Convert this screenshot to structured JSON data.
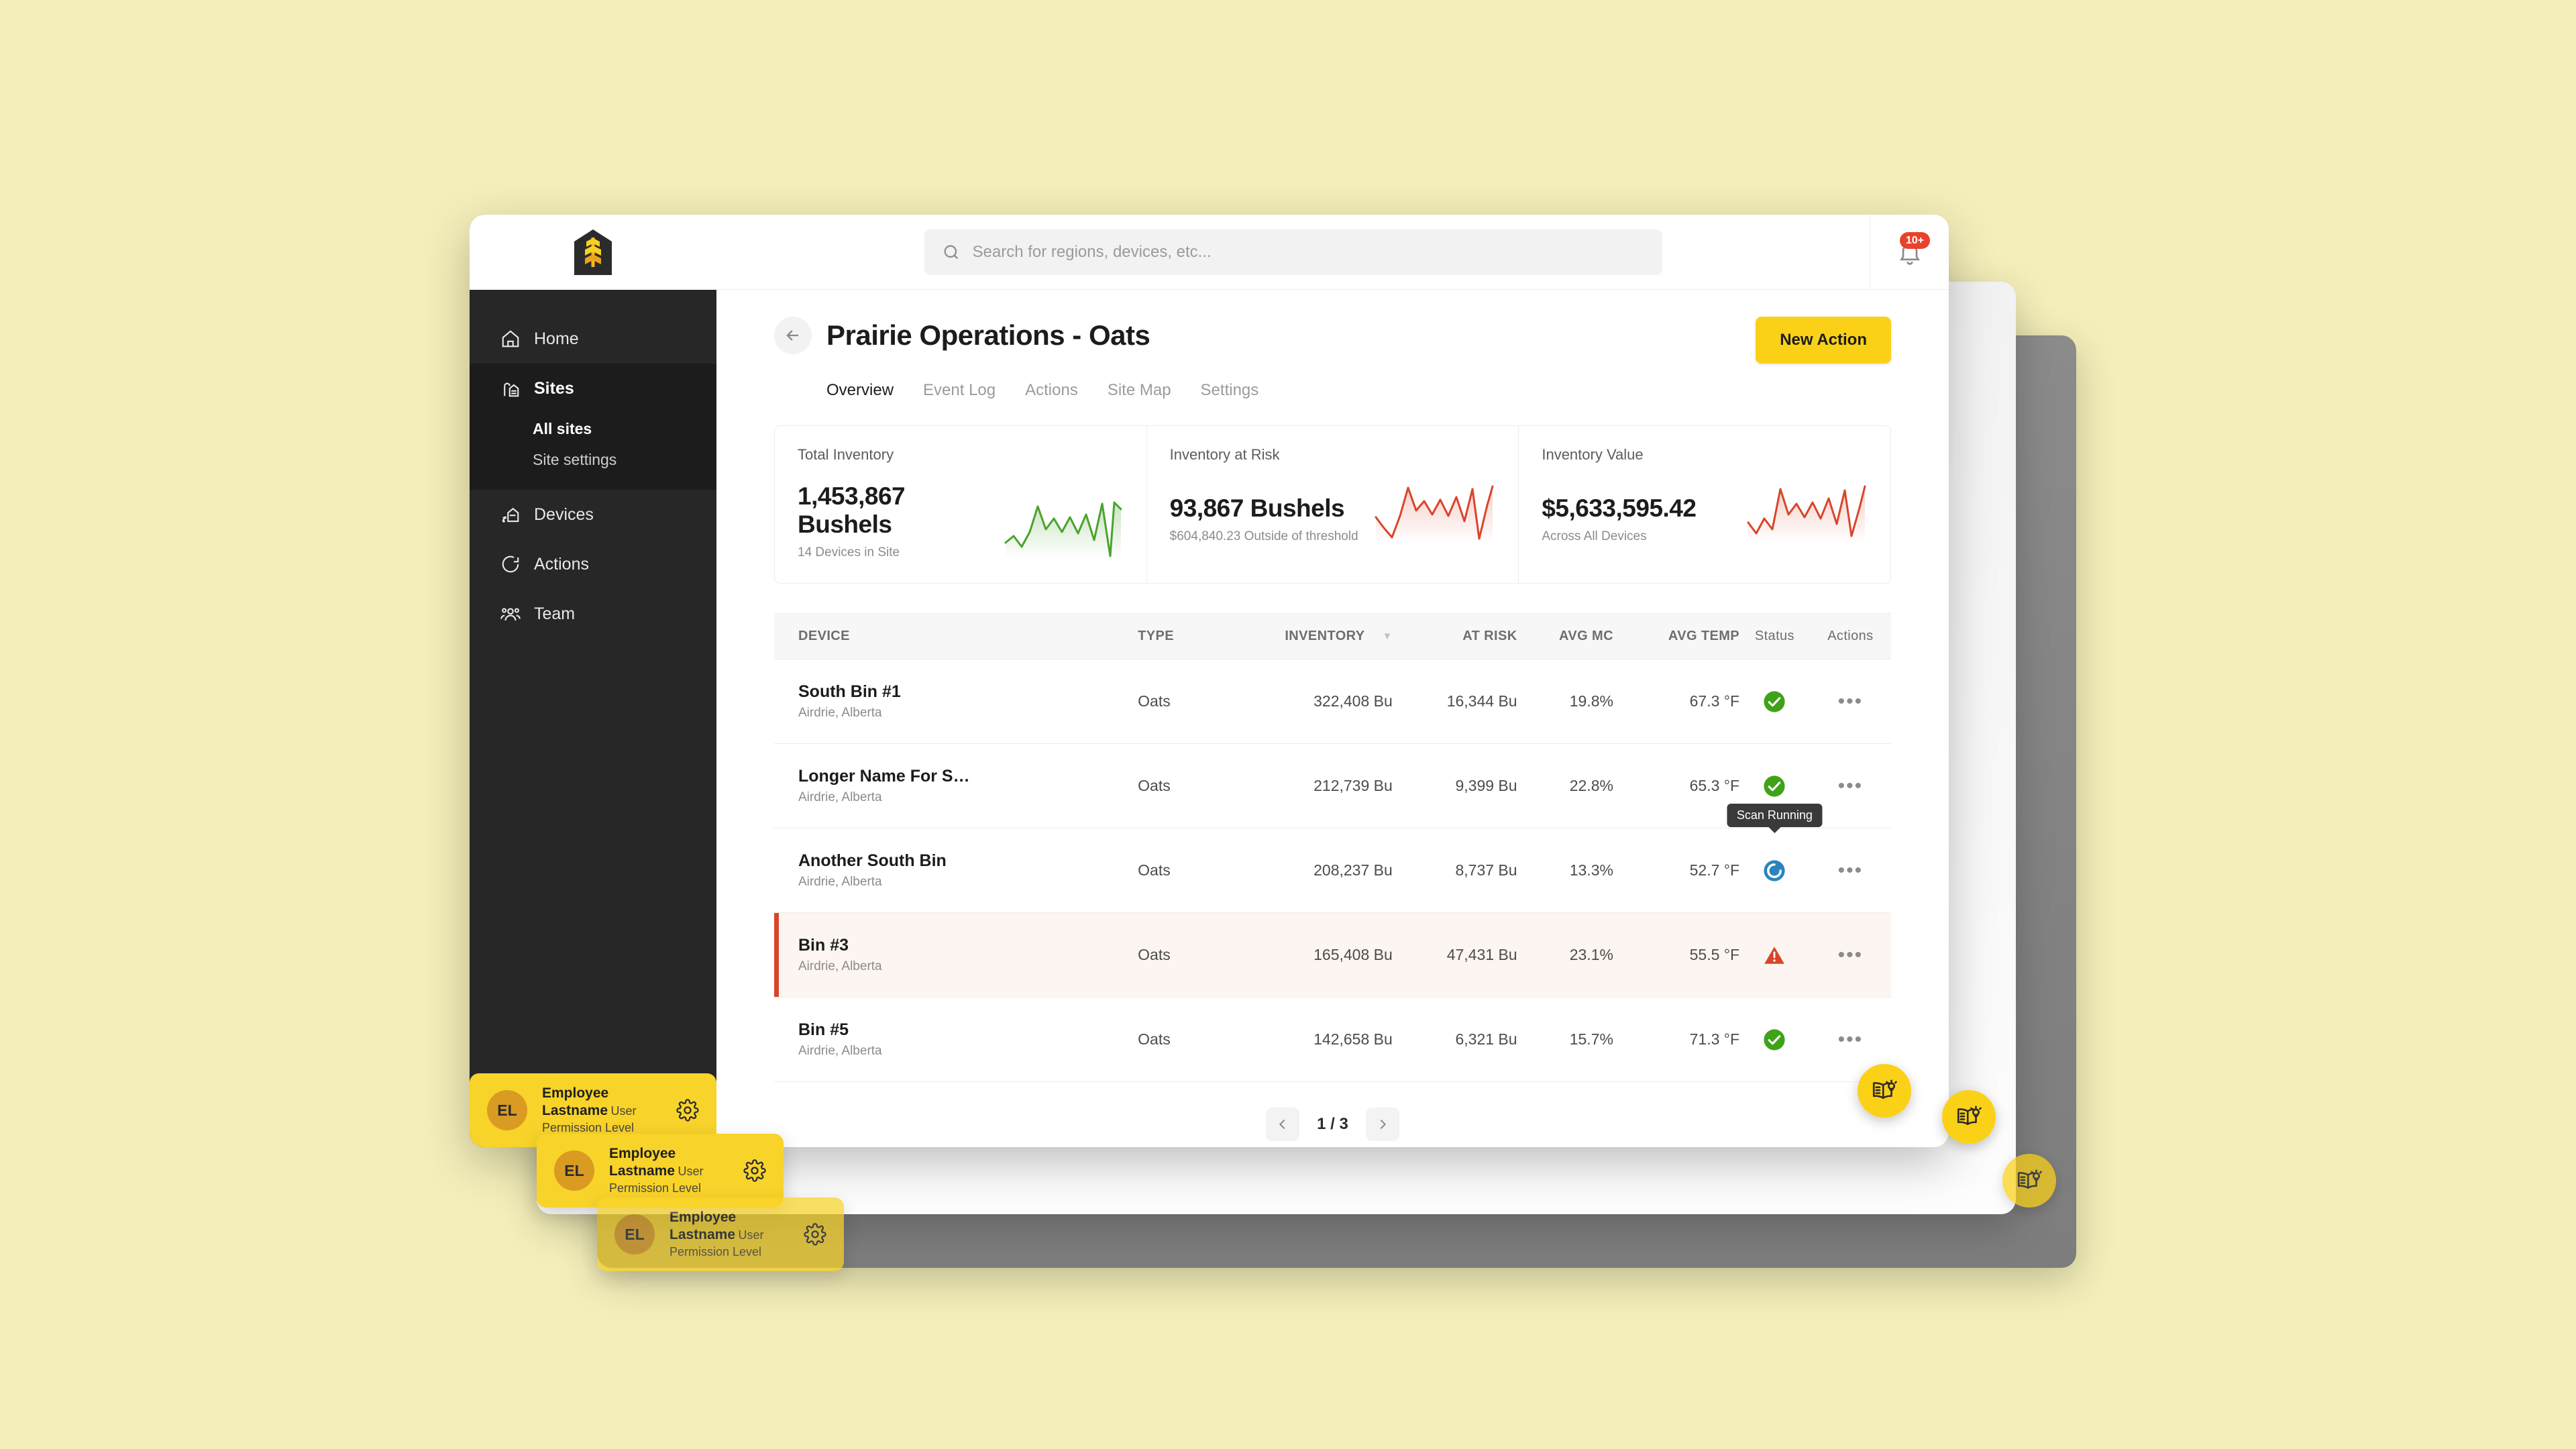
{
  "brand": {
    "logo_name": "wheat-shield-logo",
    "accent": "#fbd117",
    "dark": "#272727"
  },
  "search": {
    "placeholder": "Search for regions, devices, etc...",
    "value": ""
  },
  "notifications": {
    "badge": "10+",
    "icon": "bell-icon"
  },
  "sidebar": {
    "items": [
      {
        "label": "Home",
        "icon": "home-icon",
        "active": false
      },
      {
        "label": "Sites",
        "icon": "silo-icon",
        "active": true
      },
      {
        "label": "Devices",
        "icon": "device-icon",
        "active": false
      },
      {
        "label": "Actions",
        "icon": "actions-icon",
        "active": false
      },
      {
        "label": "Team",
        "icon": "team-icon",
        "active": false
      }
    ],
    "sub_items": [
      {
        "label": "All sites",
        "active": true
      },
      {
        "label": "Site settings",
        "active": false
      }
    ],
    "profile": {
      "initials": "EL",
      "name": "Employee Lastname",
      "role": "User Permission Level",
      "settings_icon": "gear-icon"
    }
  },
  "header": {
    "title": "Prairie Operations - Oats",
    "back_icon": "arrow-left-icon",
    "primary_button": "New Action",
    "tabs": [
      {
        "label": "Overview",
        "active": true
      },
      {
        "label": "Event Log",
        "active": false
      },
      {
        "label": "Actions",
        "active": false
      },
      {
        "label": "Site Map",
        "active": false
      },
      {
        "label": "Settings",
        "active": false
      }
    ]
  },
  "stats": [
    {
      "label": "Total Inventory",
      "value": "1,453,867 Bushels",
      "sub": "14 Devices in Site",
      "color": "#4aa32e"
    },
    {
      "label": "Inventory at Risk",
      "value": "93,867 Bushels",
      "sub": "$604,840.23 Outside of threshold",
      "color": "#d9452a"
    },
    {
      "label": "Inventory Value",
      "value": "$5,633,595.42",
      "sub": "Across All Devices",
      "color": "#d9452a"
    }
  ],
  "chart_data": [
    {
      "type": "line",
      "title": "Total Inventory",
      "series": [
        {
          "name": "Total Inventory",
          "values": [
            30,
            46,
            28,
            62,
            100,
            52,
            72,
            48,
            70,
            44,
            76,
            36,
            96,
            14,
            100,
            88
          ]
        }
      ],
      "color": "#4aa32e",
      "grid": false,
      "legend": "none",
      "ylim": [
        0,
        100
      ]
    },
    {
      "type": "line",
      "title": "Inventory at Risk",
      "series": [
        {
          "name": "Inventory at Risk",
          "values": [
            44,
            30,
            14,
            46,
            100,
            58,
            72,
            50,
            72,
            46,
            76,
            38,
            94,
            14,
            66,
            100
          ]
        }
      ],
      "color": "#d9452a",
      "grid": false,
      "legend": "none",
      "ylim": [
        0,
        100
      ]
    },
    {
      "type": "line",
      "title": "Inventory Value",
      "series": [
        {
          "name": "Inventory Value",
          "values": [
            36,
            22,
            42,
            28,
            98,
            46,
            70,
            44,
            68,
            40,
            80,
            34,
            92,
            18,
            62,
            100
          ]
        }
      ],
      "color": "#d9452a",
      "grid": false,
      "legend": "none",
      "ylim": [
        0,
        100
      ]
    }
  ],
  "table": {
    "columns": [
      "DEVICE",
      "TYPE",
      "INVENTORY",
      "AT RISK",
      "AVG MC",
      "AVG TEMP",
      "Status",
      "Actions"
    ],
    "sorted_column": "INVENTORY",
    "sort_direction": "desc",
    "rows": [
      {
        "device": "South Bin #1",
        "location": "Airdrie, Alberta",
        "type": "Oats",
        "inventory": "322,408 Bu",
        "at_risk": "16,344 Bu",
        "avg_mc": "19.8%",
        "avg_temp": "67.3 °F",
        "status": "ok",
        "actions": "•••",
        "alert": false
      },
      {
        "device": "Longer Name For South Bi...",
        "location": "Airdrie, Alberta",
        "type": "Oats",
        "inventory": "212,739 Bu",
        "at_risk": "9,399 Bu",
        "avg_mc": "22.8%",
        "avg_temp": "65.3 °F",
        "status": "ok",
        "actions": "•••",
        "alert": false
      },
      {
        "device": "Another South Bin",
        "location": "Airdrie, Alberta",
        "type": "Oats",
        "inventory": "208,237 Bu",
        "at_risk": "8,737 Bu",
        "avg_mc": "13.3%",
        "avg_temp": "52.7 °F",
        "status": "scanning",
        "tooltip": "Scan Running",
        "actions": "•••",
        "alert": false
      },
      {
        "device": "Bin #3",
        "location": "Airdrie, Alberta",
        "type": "Oats",
        "inventory": "165,408 Bu",
        "at_risk": "47,431 Bu",
        "avg_mc": "23.1%",
        "avg_temp": "55.5 °F",
        "status": "alert",
        "actions": "•••",
        "alert": true
      },
      {
        "device": "Bin #5",
        "location": "Airdrie, Alberta",
        "type": "Oats",
        "inventory": "142,658 Bu",
        "at_risk": "6,321 Bu",
        "avg_mc": "15.7%",
        "avg_temp": "71.3 °F",
        "status": "ok",
        "actions": "•••",
        "alert": false
      }
    ]
  },
  "pagination": {
    "prev_icon": "chevron-left-icon",
    "next_icon": "chevron-right-icon",
    "label": "1 / 3"
  },
  "fab": {
    "icon": "book-lightbulb-icon"
  }
}
